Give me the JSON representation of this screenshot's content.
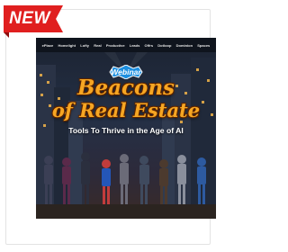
{
  "ribbon": {
    "label": "NEW"
  },
  "poster": {
    "sponsors": [
      "ePlace",
      "Homelight",
      "Lofty",
      "Real",
      "Productive",
      "Leads",
      "Offrs",
      "Dotloop",
      "Dominion",
      "Spaces"
    ],
    "badge": "Webinar",
    "title_line1": "Beacons",
    "title_line2": "of Real Estate",
    "subtitle": "Tools To Thrive in the Age of AI"
  },
  "colors": {
    "ribbon": "#e01f1f",
    "title": "#f6a623",
    "badge": "#1e8fe0"
  }
}
